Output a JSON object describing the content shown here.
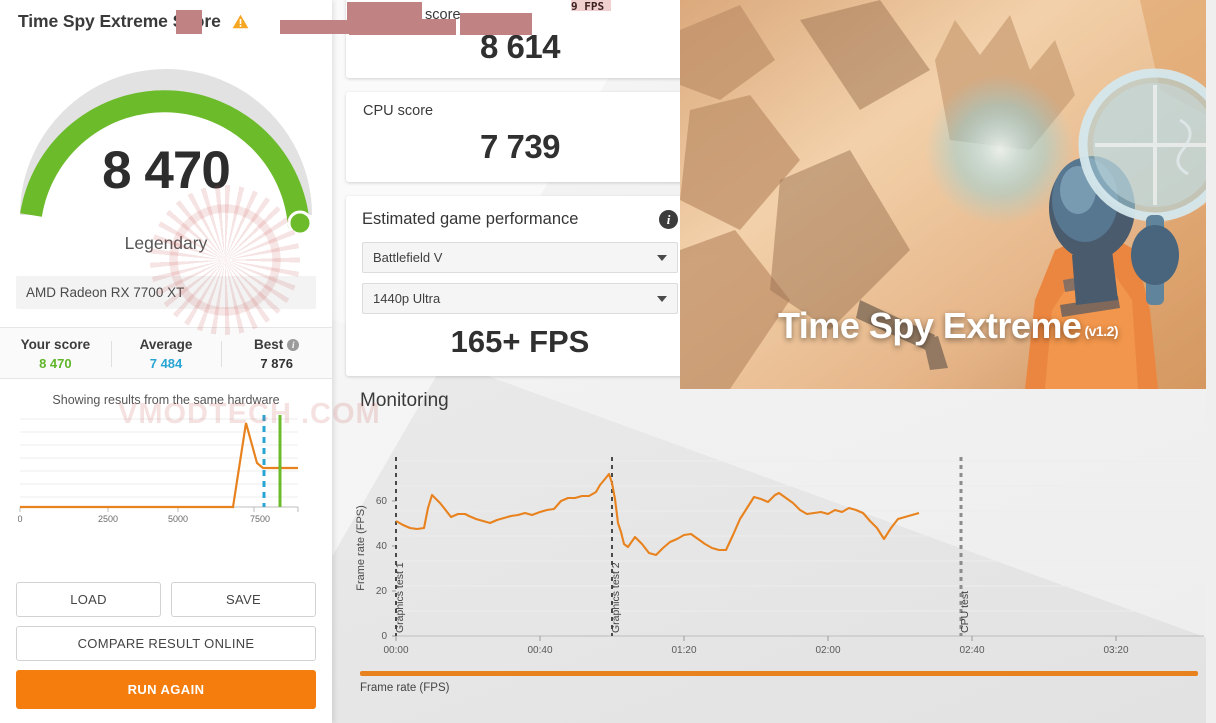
{
  "left_panel": {
    "title": "Time Spy Extreme Score",
    "warning_icon": "warning-triangle-icon",
    "gauge": {
      "score": "8 470",
      "classification": "Legendary",
      "arc_color": "#6cbb2b",
      "track_color": "#dcdcdc",
      "percent": 0.92
    },
    "gpu_name": "AMD Radeon RX 7700 XT",
    "comparison": [
      {
        "label": "Your score",
        "value": "8 470",
        "color": "#5fb52a"
      },
      {
        "label": "Average",
        "value": "7 484",
        "color": "#29a5d4"
      },
      {
        "label": "Best",
        "value": "7 876",
        "color": "#333333",
        "has_info": true
      }
    ],
    "same_hardware_note": "Showing results from the same hardware",
    "buttons": {
      "load": "LOAD",
      "save": "SAVE",
      "compare": "COMPARE RESULT ONLINE",
      "run_again": "RUN AGAIN"
    }
  },
  "cards": {
    "graphics": {
      "label": "Graphics score",
      "value": "8 614",
      "redacted": true
    },
    "cpu": {
      "label": "CPU score",
      "value": "7 739"
    }
  },
  "estimated_game_performance": {
    "title": "Estimated game performance",
    "info_icon": "info-circle-icon",
    "game": "Battlefield V",
    "preset": "1440p Ultra",
    "fps": "165+ FPS"
  },
  "hero": {
    "title": "Time Spy Extreme",
    "version": "(v1.2)"
  },
  "monitoring": {
    "title": "Monitoring",
    "legend_label": "Frame rate (FPS)",
    "legend_color": "#e8821e"
  },
  "watermark": {
    "text": "VMODTECH .COM"
  },
  "overlay_fps": "9 FPS",
  "chart_data": [
    {
      "type": "line",
      "name": "score-distribution",
      "title": "Showing results from the same hardware",
      "xlabel": "",
      "ylabel": "",
      "xlim": [
        0,
        9000
      ],
      "xticks": [
        0,
        2500,
        5000,
        7500
      ],
      "xtick_labels": [
        "0",
        "2500",
        "5000",
        "7500"
      ],
      "grid": true,
      "series": [
        {
          "name": "Result distribution",
          "color": "#e8821e",
          "x": [
            0,
            1000,
            2000,
            3000,
            4000,
            5000,
            6000,
            6700,
            6900,
            7250,
            7400,
            7500,
            7600,
            8000
          ],
          "y": [
            0,
            0,
            0,
            0,
            0,
            0,
            0,
            0,
            0.02,
            0.95,
            0.55,
            0.3,
            0.3,
            0.3
          ]
        }
      ],
      "markers": [
        {
          "name": "average-marker",
          "x": 7484,
          "color": "#29a5d4",
          "style": "dashed"
        },
        {
          "name": "your-score-marker",
          "x": 7876,
          "color": "#6cbb2b",
          "style": "solid"
        }
      ]
    },
    {
      "type": "line",
      "name": "frame-rate-monitoring",
      "title": "Monitoring",
      "xlabel": "",
      "ylabel": "Frame rate (FPS)",
      "ylim": [
        0,
        80
      ],
      "yticks": [
        0,
        20,
        40,
        60
      ],
      "ytick_labels": [
        "0",
        "20",
        "40",
        "60"
      ],
      "xlim": [
        0,
        225
      ],
      "xticks": [
        0,
        40,
        80,
        120,
        160,
        200
      ],
      "xtick_labels": [
        "00:00",
        "00:40",
        "01:20",
        "02:00",
        "02:40",
        "03:20"
      ],
      "grid": true,
      "legend": "Frame rate (FPS)",
      "series": [
        {
          "name": "Frame rate (FPS)",
          "color": "#e8821e",
          "x": [
            0,
            2,
            4,
            6,
            8,
            9,
            10,
            11,
            12,
            13,
            15,
            17,
            19,
            20,
            22,
            24,
            26,
            28,
            30,
            32,
            34,
            36,
            38,
            40,
            42,
            44,
            46,
            48,
            50,
            52,
            54,
            55,
            56,
            57,
            58,
            59,
            60,
            61,
            62,
            63,
            64,
            66,
            68,
            70,
            72,
            74,
            76,
            78,
            80,
            82,
            84,
            86,
            88,
            90,
            92,
            94,
            96,
            98,
            100,
            102,
            104,
            106,
            108,
            110,
            112,
            114,
            116,
            118,
            120,
            122,
            124,
            126,
            128,
            130,
            132,
            134,
            136,
            138,
            140,
            142,
            144,
            146,
            148,
            150
          ],
          "y": [
            51,
            49,
            48,
            47.5,
            48,
            57,
            62.5,
            61,
            59,
            57,
            53,
            54,
            54,
            53.5,
            52,
            51,
            50,
            51.5,
            52.5,
            53.5,
            54,
            54.5,
            54,
            55,
            56,
            56.5,
            60,
            61.5,
            61.5,
            62,
            62,
            64,
            67,
            70,
            72,
            68,
            61,
            50,
            46,
            41,
            40,
            44,
            41,
            37,
            36,
            39,
            42,
            43,
            45,
            45.5,
            43,
            41,
            39.5,
            38.5,
            38.5,
            45,
            52,
            57,
            62,
            61,
            60,
            63,
            63.5,
            61,
            59,
            56,
            54,
            54.5,
            55,
            54,
            56,
            55.5,
            57,
            56,
            55,
            51,
            48,
            43,
            48,
            52,
            53,
            54,
            54.5
          ]
        }
      ],
      "annotations": [
        {
          "name": "graphics-test-1-marker",
          "label": "Graphics test 1",
          "x": 0
        },
        {
          "name": "graphics-test-2-marker",
          "label": "Graphics test 2",
          "x": 60
        },
        {
          "name": "cpu-test-marker",
          "label": "CPU test",
          "x": 157
        }
      ]
    }
  ]
}
